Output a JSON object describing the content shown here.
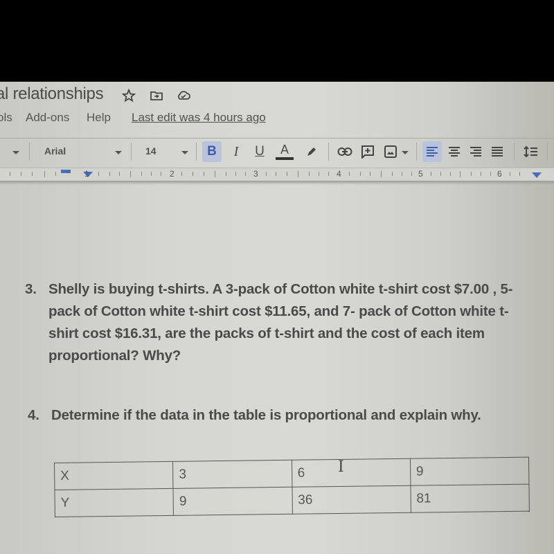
{
  "window": {
    "doc_title_fragment": "al relationships",
    "title_icons": [
      "star-icon",
      "move-to-folder-icon",
      "cloud-saved-icon"
    ]
  },
  "menu": {
    "items": [
      "ols",
      "Add-ons",
      "Help"
    ],
    "last_edit": "Last edit was 4 hours ago"
  },
  "toolbar": {
    "font_family": "Arial",
    "font_size": "14",
    "bold_label": "B",
    "italic_label": "I",
    "underline_label": "U",
    "text_color_label": "A",
    "text_color_bar": "#333333",
    "accent": "#3e5da6",
    "buttons": [
      "style-dropdown",
      "font-dropdown",
      "font-size-dropdown",
      "bold",
      "italic",
      "underline",
      "text-color",
      "highlight",
      "insert-link",
      "add-comment",
      "insert-image",
      "align-left",
      "align-center",
      "align-right",
      "justify",
      "line-spacing"
    ]
  },
  "ruler": {
    "labels": [
      "1",
      "2",
      "3",
      "4",
      "5",
      "6"
    ]
  },
  "document": {
    "question3": {
      "number": "3.",
      "text": "Shelly is buying t-shirts. A 3-pack of Cotton white t-shirt cost $7.00 , 5- pack of Cotton white t-shirt cost $11.65, and 7- pack of Cotton white t-shirt cost $16.31, are the packs of t-shirt and the cost of each item proportional? Why?"
    },
    "question4": {
      "number": "4.",
      "text": "Determine if the data in the table is proportional and explain why."
    },
    "table": {
      "rows": [
        [
          "X",
          "3",
          "6",
          "9"
        ],
        [
          "Y",
          "9",
          "36",
          "81"
        ]
      ]
    }
  }
}
